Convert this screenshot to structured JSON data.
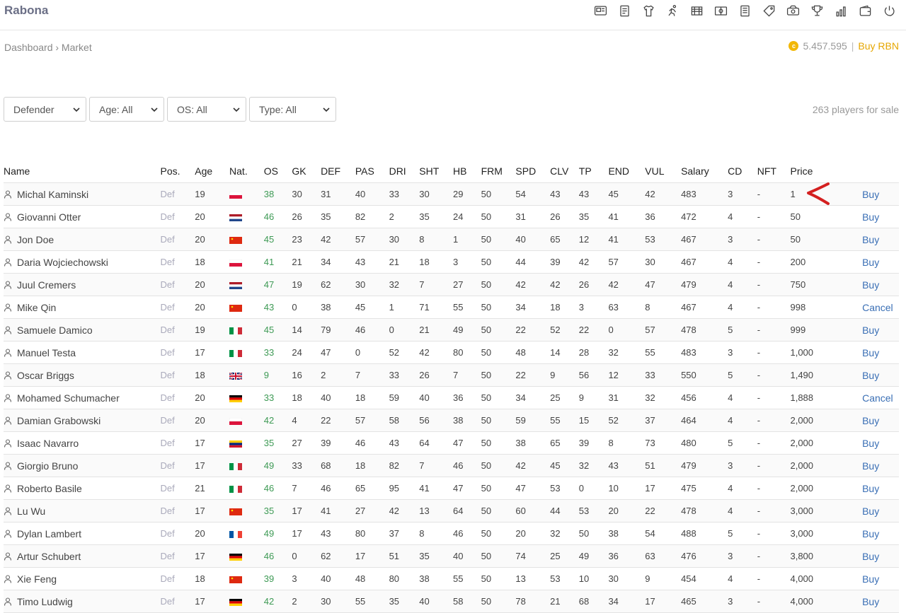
{
  "app": {
    "title": "Rabona"
  },
  "nav_icons": [
    "scout-card-icon",
    "document-icon",
    "jersey-icon",
    "runner-icon",
    "stadium-icon",
    "pitch-icon",
    "notes-icon",
    "tag-icon",
    "money-icon",
    "trophy-icon",
    "bar-chart-icon",
    "wallet-icon",
    "power-icon"
  ],
  "breadcrumb": {
    "text": "Dashboard › Market"
  },
  "balance": {
    "amount": "5.457.595",
    "separator": "|",
    "buy_label": "Buy RBN"
  },
  "filters": {
    "position": "Defender",
    "age": "Age: All",
    "os": "OS: All",
    "type": "Type: All"
  },
  "count_text": "263 players for sale",
  "colors": {
    "accent_link": "#3a6fb5",
    "os_green": "#3e9a55",
    "coin": "#f2b705",
    "buy_rbn": "#e6a600",
    "annotation": "#d42020"
  },
  "table": {
    "headers": [
      "Name",
      "Pos.",
      "Age",
      "Nat.",
      "OS",
      "GK",
      "DEF",
      "PAS",
      "DRI",
      "SHT",
      "HB",
      "FRM",
      "SPD",
      "CLV",
      "TP",
      "END",
      "VUL",
      "Salary",
      "CD",
      "NFT",
      "Price",
      ""
    ],
    "rows": [
      {
        "name": "Michal Kaminski",
        "pos": "Def",
        "age": "19",
        "nat": "PL",
        "os": "38",
        "gk": "30",
        "def": "31",
        "pas": "40",
        "dri": "33",
        "sht": "30",
        "hb": "29",
        "frm": "50",
        "spd": "54",
        "clv": "43",
        "tp": "43",
        "end": "45",
        "vul": "42",
        "salary": "483",
        "cd": "3",
        "nft": "-",
        "price": "1",
        "action": "Buy"
      },
      {
        "name": "Giovanni Otter",
        "pos": "Def",
        "age": "20",
        "nat": "NL",
        "os": "46",
        "gk": "26",
        "def": "35",
        "pas": "82",
        "dri": "2",
        "sht": "35",
        "hb": "24",
        "frm": "50",
        "spd": "31",
        "clv": "26",
        "tp": "35",
        "end": "41",
        "vul": "36",
        "salary": "472",
        "cd": "4",
        "nft": "-",
        "price": "50",
        "action": "Buy"
      },
      {
        "name": "Jon Doe",
        "pos": "Def",
        "age": "20",
        "nat": "CN",
        "os": "45",
        "gk": "23",
        "def": "42",
        "pas": "57",
        "dri": "30",
        "sht": "8",
        "hb": "1",
        "frm": "50",
        "spd": "40",
        "clv": "65",
        "tp": "12",
        "end": "41",
        "vul": "53",
        "salary": "467",
        "cd": "3",
        "nft": "-",
        "price": "50",
        "action": "Buy"
      },
      {
        "name": "Daria Wojciechowski",
        "pos": "Def",
        "age": "18",
        "nat": "PL",
        "os": "41",
        "gk": "21",
        "def": "34",
        "pas": "43",
        "dri": "21",
        "sht": "18",
        "hb": "3",
        "frm": "50",
        "spd": "44",
        "clv": "39",
        "tp": "42",
        "end": "57",
        "vul": "30",
        "salary": "467",
        "cd": "4",
        "nft": "-",
        "price": "200",
        "action": "Buy"
      },
      {
        "name": "Juul Cremers",
        "pos": "Def",
        "age": "20",
        "nat": "NL",
        "os": "47",
        "gk": "19",
        "def": "62",
        "pas": "30",
        "dri": "32",
        "sht": "7",
        "hb": "27",
        "frm": "50",
        "spd": "42",
        "clv": "42",
        "tp": "26",
        "end": "42",
        "vul": "47",
        "salary": "479",
        "cd": "4",
        "nft": "-",
        "price": "750",
        "action": "Buy"
      },
      {
        "name": "Mike Qin",
        "pos": "Def",
        "age": "20",
        "nat": "CN",
        "os": "43",
        "gk": "0",
        "def": "38",
        "pas": "45",
        "dri": "1",
        "sht": "71",
        "hb": "55",
        "frm": "50",
        "spd": "34",
        "clv": "18",
        "tp": "3",
        "end": "63",
        "vul": "8",
        "salary": "467",
        "cd": "4",
        "nft": "-",
        "price": "998",
        "action": "Cancel"
      },
      {
        "name": "Samuele Damico",
        "pos": "Def",
        "age": "19",
        "nat": "IT",
        "os": "45",
        "gk": "14",
        "def": "79",
        "pas": "46",
        "dri": "0",
        "sht": "21",
        "hb": "49",
        "frm": "50",
        "spd": "22",
        "clv": "52",
        "tp": "22",
        "end": "0",
        "vul": "57",
        "salary": "478",
        "cd": "5",
        "nft": "-",
        "price": "999",
        "action": "Buy"
      },
      {
        "name": "Manuel Testa",
        "pos": "Def",
        "age": "17",
        "nat": "IT",
        "os": "33",
        "gk": "24",
        "def": "47",
        "pas": "0",
        "dri": "52",
        "sht": "42",
        "hb": "80",
        "frm": "50",
        "spd": "48",
        "clv": "14",
        "tp": "28",
        "end": "32",
        "vul": "55",
        "salary": "483",
        "cd": "3",
        "nft": "-",
        "price": "1,000",
        "action": "Buy"
      },
      {
        "name": "Oscar Briggs",
        "pos": "Def",
        "age": "18",
        "nat": "GB",
        "os": "9",
        "gk": "16",
        "def": "2",
        "pas": "7",
        "dri": "33",
        "sht": "26",
        "hb": "7",
        "frm": "50",
        "spd": "22",
        "clv": "9",
        "tp": "56",
        "end": "12",
        "vul": "33",
        "salary": "550",
        "cd": "5",
        "nft": "-",
        "price": "1,490",
        "action": "Buy"
      },
      {
        "name": "Mohamed Schumacher",
        "pos": "Def",
        "age": "20",
        "nat": "DE",
        "os": "33",
        "gk": "18",
        "def": "40",
        "pas": "18",
        "dri": "59",
        "sht": "40",
        "hb": "36",
        "frm": "50",
        "spd": "34",
        "clv": "25",
        "tp": "9",
        "end": "31",
        "vul": "32",
        "salary": "456",
        "cd": "4",
        "nft": "-",
        "price": "1,888",
        "action": "Cancel"
      },
      {
        "name": "Damian Grabowski",
        "pos": "Def",
        "age": "20",
        "nat": "PL",
        "os": "42",
        "gk": "4",
        "def": "22",
        "pas": "57",
        "dri": "58",
        "sht": "56",
        "hb": "38",
        "frm": "50",
        "spd": "59",
        "clv": "55",
        "tp": "15",
        "end": "52",
        "vul": "37",
        "salary": "464",
        "cd": "4",
        "nft": "-",
        "price": "2,000",
        "action": "Buy"
      },
      {
        "name": "Isaac Navarro",
        "pos": "Def",
        "age": "17",
        "nat": "VE",
        "os": "35",
        "gk": "27",
        "def": "39",
        "pas": "46",
        "dri": "43",
        "sht": "64",
        "hb": "47",
        "frm": "50",
        "spd": "38",
        "clv": "65",
        "tp": "39",
        "end": "8",
        "vul": "73",
        "salary": "480",
        "cd": "5",
        "nft": "-",
        "price": "2,000",
        "action": "Buy"
      },
      {
        "name": "Giorgio Bruno",
        "pos": "Def",
        "age": "17",
        "nat": "IT",
        "os": "49",
        "gk": "33",
        "def": "68",
        "pas": "18",
        "dri": "82",
        "sht": "7",
        "hb": "46",
        "frm": "50",
        "spd": "42",
        "clv": "45",
        "tp": "32",
        "end": "43",
        "vul": "51",
        "salary": "479",
        "cd": "3",
        "nft": "-",
        "price": "2,000",
        "action": "Buy"
      },
      {
        "name": "Roberto Basile",
        "pos": "Def",
        "age": "21",
        "nat": "IT",
        "os": "46",
        "gk": "7",
        "def": "46",
        "pas": "65",
        "dri": "95",
        "sht": "41",
        "hb": "47",
        "frm": "50",
        "spd": "47",
        "clv": "53",
        "tp": "0",
        "end": "10",
        "vul": "17",
        "salary": "475",
        "cd": "4",
        "nft": "-",
        "price": "2,000",
        "action": "Buy"
      },
      {
        "name": "Lu Wu",
        "pos": "Def",
        "age": "17",
        "nat": "CN",
        "os": "35",
        "gk": "17",
        "def": "41",
        "pas": "27",
        "dri": "42",
        "sht": "13",
        "hb": "64",
        "frm": "50",
        "spd": "60",
        "clv": "44",
        "tp": "53",
        "end": "20",
        "vul": "22",
        "salary": "478",
        "cd": "4",
        "nft": "-",
        "price": "3,000",
        "action": "Buy"
      },
      {
        "name": "Dylan Lambert",
        "pos": "Def",
        "age": "20",
        "nat": "FR",
        "os": "49",
        "gk": "17",
        "def": "43",
        "pas": "80",
        "dri": "37",
        "sht": "8",
        "hb": "46",
        "frm": "50",
        "spd": "20",
        "clv": "32",
        "tp": "50",
        "end": "38",
        "vul": "54",
        "salary": "488",
        "cd": "5",
        "nft": "-",
        "price": "3,000",
        "action": "Buy"
      },
      {
        "name": "Artur Schubert",
        "pos": "Def",
        "age": "17",
        "nat": "DE",
        "os": "46",
        "gk": "0",
        "def": "62",
        "pas": "17",
        "dri": "51",
        "sht": "35",
        "hb": "40",
        "frm": "50",
        "spd": "74",
        "clv": "25",
        "tp": "49",
        "end": "36",
        "vul": "63",
        "salary": "476",
        "cd": "3",
        "nft": "-",
        "price": "3,800",
        "action": "Buy"
      },
      {
        "name": "Xie Feng",
        "pos": "Def",
        "age": "18",
        "nat": "CN",
        "os": "39",
        "gk": "3",
        "def": "40",
        "pas": "48",
        "dri": "80",
        "sht": "38",
        "hb": "55",
        "frm": "50",
        "spd": "13",
        "clv": "53",
        "tp": "10",
        "end": "30",
        "vul": "9",
        "salary": "454",
        "cd": "4",
        "nft": "-",
        "price": "4,000",
        "action": "Buy"
      },
      {
        "name": "Timo Ludwig",
        "pos": "Def",
        "age": "17",
        "nat": "DE",
        "os": "42",
        "gk": "2",
        "def": "30",
        "pas": "55",
        "dri": "35",
        "sht": "40",
        "hb": "58",
        "frm": "50",
        "spd": "78",
        "clv": "21",
        "tp": "68",
        "end": "34",
        "vul": "17",
        "salary": "465",
        "cd": "3",
        "nft": "-",
        "price": "4,000",
        "action": "Buy"
      }
    ]
  }
}
